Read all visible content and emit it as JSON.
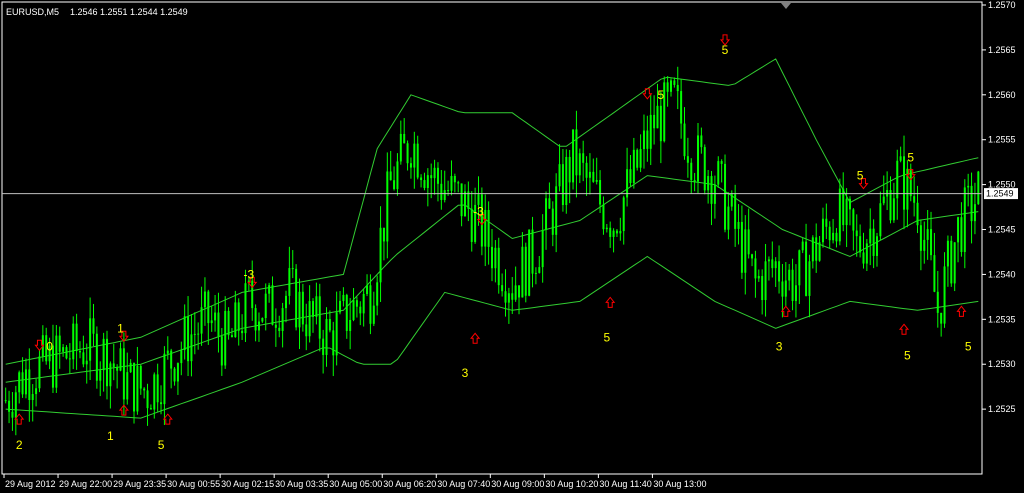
{
  "header": {
    "symbol": "EURUSD,M5",
    "ohlc": "1.2546 1.2551 1.2544 1.2549"
  },
  "colors": {
    "background": "#000000",
    "frame": "#ffffff",
    "candle": "#00ff00",
    "band": "#32cd32",
    "current_line": "#c0c0c0",
    "arrow": "#ff0000",
    "annotation": "#ffff00",
    "text": "#ffffff"
  },
  "chart_data": {
    "type": "candlestick",
    "title": "EURUSD,M5",
    "y_ticks": [
      "1.2570",
      "1.2565",
      "1.2560",
      "1.2555",
      "1.2550",
      "1.2545",
      "1.2540",
      "1.2535",
      "1.2530",
      "1.2525"
    ],
    "ylim": [
      1.2518,
      1.257
    ],
    "x_ticks": [
      "29 Aug 2012",
      "29 Aug 22:00",
      "29 Aug 23:35",
      "30 Aug 00:55",
      "30 Aug 02:15",
      "30 Aug 03:35",
      "30 Aug 05:00",
      "30 Aug 06:20",
      "30 Aug 07:40",
      "30 Aug 09:00",
      "30 Aug 10:20",
      "30 Aug 11:40",
      "30 Aug 13:00"
    ],
    "current_price": "1.2549",
    "close_path": [
      [
        0,
        1.2526
      ],
      [
        6,
        1.2529
      ],
      [
        12,
        1.253
      ],
      [
        18,
        1.2531
      ],
      [
        24,
        1.2532
      ],
      [
        30,
        1.2531
      ],
      [
        36,
        1.2528
      ],
      [
        42,
        1.2527
      ],
      [
        48,
        1.253
      ],
      [
        54,
        1.2533
      ],
      [
        60,
        1.2535
      ],
      [
        66,
        1.2532
      ],
      [
        72,
        1.2537
      ],
      [
        78,
        1.2536
      ],
      [
        84,
        1.2538
      ],
      [
        90,
        1.2535
      ],
      [
        96,
        1.2533
      ],
      [
        102,
        1.2536
      ],
      [
        108,
        1.2538
      ],
      [
        114,
        1.255
      ],
      [
        120,
        1.2555
      ],
      [
        126,
        1.2551
      ],
      [
        132,
        1.2549
      ],
      [
        138,
        1.2547
      ],
      [
        144,
        1.2543
      ],
      [
        150,
        1.2539
      ],
      [
        156,
        1.2542
      ],
      [
        162,
        1.2547
      ],
      [
        168,
        1.2553
      ],
      [
        174,
        1.2549
      ],
      [
        180,
        1.2546
      ],
      [
        186,
        1.2551
      ],
      [
        192,
        1.2557
      ],
      [
        198,
        1.2559
      ],
      [
        204,
        1.2553
      ],
      [
        210,
        1.2551
      ],
      [
        216,
        1.2545
      ],
      [
        222,
        1.2539
      ],
      [
        228,
        1.2541
      ],
      [
        234,
        1.2539
      ],
      [
        240,
        1.2543
      ],
      [
        246,
        1.2547
      ],
      [
        252,
        1.2543
      ],
      [
        258,
        1.2546
      ],
      [
        264,
        1.2551
      ],
      [
        270,
        1.2548
      ],
      [
        276,
        1.2536
      ],
      [
        282,
        1.2545
      ],
      [
        288,
        1.2549
      ]
    ],
    "bands": {
      "upper": [
        [
          0,
          1.253
        ],
        [
          40,
          1.2533
        ],
        [
          70,
          1.2538
        ],
        [
          100,
          1.254
        ],
        [
          110,
          1.2554
        ],
        [
          120,
          1.256
        ],
        [
          135,
          1.2558
        ],
        [
          150,
          1.2558
        ],
        [
          165,
          1.2554
        ],
        [
          180,
          1.2558
        ],
        [
          195,
          1.2562
        ],
        [
          215,
          1.2561
        ],
        [
          228,
          1.2564
        ],
        [
          240,
          1.2555
        ],
        [
          250,
          1.2548
        ],
        [
          265,
          1.2551
        ],
        [
          288,
          1.2553
        ]
      ],
      "middle": [
        [
          0,
          1.2528
        ],
        [
          40,
          1.253
        ],
        [
          70,
          1.2534
        ],
        [
          100,
          1.2536
        ],
        [
          115,
          1.2542
        ],
        [
          135,
          1.2548
        ],
        [
          150,
          1.2544
        ],
        [
          170,
          1.2546
        ],
        [
          190,
          1.2551
        ],
        [
          210,
          1.255
        ],
        [
          230,
          1.2545
        ],
        [
          250,
          1.2542
        ],
        [
          270,
          1.2546
        ],
        [
          288,
          1.2547
        ]
      ],
      "lower": [
        [
          0,
          1.2525
        ],
        [
          40,
          1.2524
        ],
        [
          70,
          1.2528
        ],
        [
          95,
          1.2532
        ],
        [
          105,
          1.253
        ],
        [
          115,
          1.253
        ],
        [
          130,
          1.2538
        ],
        [
          150,
          1.2536
        ],
        [
          170,
          1.2537
        ],
        [
          190,
          1.2542
        ],
        [
          210,
          1.2537
        ],
        [
          228,
          1.2534
        ],
        [
          250,
          1.2537
        ],
        [
          270,
          1.2536
        ],
        [
          288,
          1.2537
        ]
      ]
    },
    "arrows": [
      {
        "dir": "down",
        "i": 10,
        "price": 1.2532
      },
      {
        "dir": "down",
        "i": 35,
        "price": 1.2533
      },
      {
        "dir": "down",
        "i": 73,
        "price": 1.2539
      },
      {
        "dir": "down",
        "i": 141,
        "price": 1.2546
      },
      {
        "dir": "down",
        "i": 190,
        "price": 1.256
      },
      {
        "dir": "down",
        "i": 213,
        "price": 1.2566
      },
      {
        "dir": "down",
        "i": 254,
        "price": 1.255
      },
      {
        "dir": "down",
        "i": 268,
        "price": 1.2551
      },
      {
        "dir": "up",
        "i": 4,
        "price": 1.2524
      },
      {
        "dir": "up",
        "i": 35,
        "price": 1.2525
      },
      {
        "dir": "up",
        "i": 48,
        "price": 1.2524
      },
      {
        "dir": "up",
        "i": 139,
        "price": 1.2533
      },
      {
        "dir": "up",
        "i": 179,
        "price": 1.2537
      },
      {
        "dir": "up",
        "i": 231,
        "price": 1.2536
      },
      {
        "dir": "up",
        "i": 266,
        "price": 1.2534
      },
      {
        "dir": "up",
        "i": 283,
        "price": 1.2536
      }
    ],
    "annotations": [
      {
        "text": "0",
        "i": 13,
        "price": 1.2532
      },
      {
        "text": "1",
        "i": 34,
        "price": 1.2534
      },
      {
        "text": "-3",
        "i": 72,
        "price": 1.254
      },
      {
        "text": "-3",
        "i": 140,
        "price": 1.2547
      },
      {
        "text": "5",
        "i": 194,
        "price": 1.256
      },
      {
        "text": "5",
        "i": 213,
        "price": 1.2565
      },
      {
        "text": "5",
        "i": 253,
        "price": 1.2551
      },
      {
        "text": "5",
        "i": 268,
        "price": 1.2553
      },
      {
        "text": "2",
        "i": 4,
        "price": 1.2521
      },
      {
        "text": "1",
        "i": 31,
        "price": 1.2522
      },
      {
        "text": "5",
        "i": 46,
        "price": 1.2521
      },
      {
        "text": "3",
        "i": 136,
        "price": 1.2529
      },
      {
        "text": "5",
        "i": 178,
        "price": 1.2533
      },
      {
        "text": "3",
        "i": 229,
        "price": 1.2532
      },
      {
        "text": "5",
        "i": 267,
        "price": 1.2531
      },
      {
        "text": "5",
        "i": 285,
        "price": 1.2532
      }
    ]
  }
}
